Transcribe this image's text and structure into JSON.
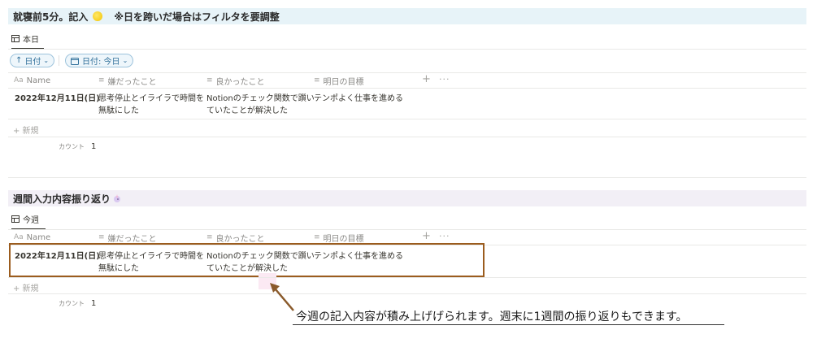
{
  "section1": {
    "title": "就寝前5分。記入",
    "note": "※日を跨いだ場合はフィルタを要調整",
    "view_tab": "本日",
    "filters": {
      "sort_label": "日付",
      "date_filter_label": "日付: 今日"
    },
    "columns": [
      "Name",
      "嫌だったこと",
      "良かったこと",
      "明日の目標"
    ],
    "rows": [
      {
        "name": "2022年12月11日(日)",
        "bad": [
          "思考停止とイライラで時間を",
          "無駄にした"
        ],
        "good": [
          "Notionのチェック関数で躓い",
          "ていたことが解決した"
        ],
        "goal": "テンポよく仕事を進める"
      }
    ],
    "new_label": "+ 新規",
    "count_label": "カウント",
    "count_value": "1"
  },
  "section2": {
    "title": "週間入力内容振り返り",
    "view_tab": "今週",
    "columns": [
      "Name",
      "嫌だったこと",
      "良かったこと",
      "明日の目標"
    ],
    "rows": [
      {
        "name": "2022年12月11日(日)",
        "bad": [
          "思考停止とイライラで時間を",
          "無駄にした"
        ],
        "good": [
          "Notionのチェック関数で躓い",
          "ていたことが解決した"
        ],
        "goal": "テンポよく仕事を進める"
      }
    ],
    "new_label": "+ 新規",
    "count_label": "カウント",
    "count_value": "1"
  },
  "annotation": {
    "caption": "今週の記入内容が積み上げげられます。週末に1週間の振り返りもできます。"
  },
  "icons": {
    "title_icon": "text-icon",
    "name_icon": "Aa",
    "table_icon": "table-icon",
    "moon": "moon-emoji",
    "unicorn": "unicorn-emoji"
  },
  "colors": {
    "section1_bg": "#e7f3f8",
    "section2_bg": "#f2eff6",
    "chip_border": "#9dc3dc",
    "chip_text": "#2f6f9a",
    "highlight_border": "#9b5c1e",
    "arrow": "#8a5a2b"
  }
}
